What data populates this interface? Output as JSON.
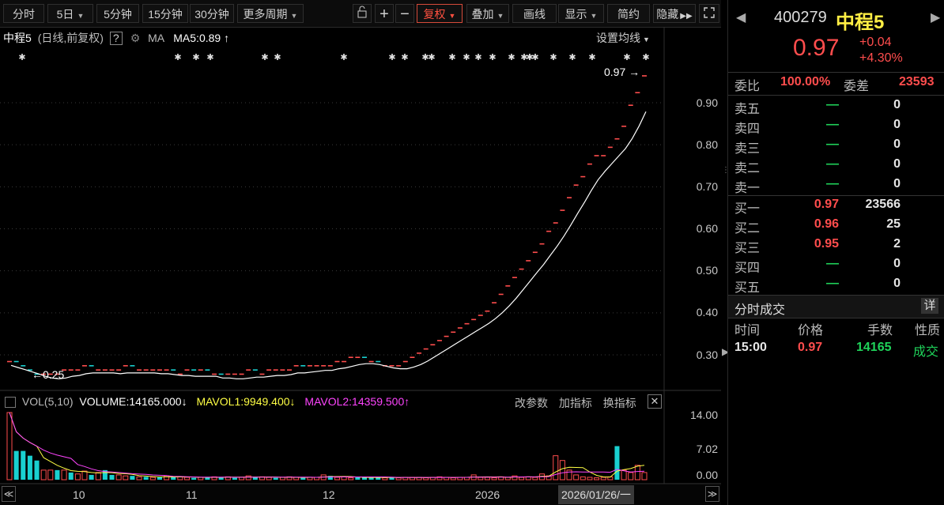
{
  "toolbar": {
    "items": [
      {
        "label": "分时"
      },
      {
        "label": "5日",
        "dropdown": true
      },
      {
        "label": "5分钟"
      },
      {
        "label": "15分钟"
      },
      {
        "label": "30分钟"
      },
      {
        "label": "更多周期",
        "dropdown": true
      }
    ],
    "right_items": [
      {
        "label": "复权",
        "dropdown": true,
        "active": true
      },
      {
        "label": "叠加",
        "dropdown": true
      },
      {
        "label": "画线"
      },
      {
        "label": "显示",
        "dropdown": true
      },
      {
        "label": "简约"
      },
      {
        "label": "隐藏"
      }
    ]
  },
  "chart_header": {
    "name": "中程5",
    "mode": "(日线,前复权)",
    "help": "?",
    "ma_label": "MA",
    "ma5": "MA5:0.89",
    "ma_settings": "设置均线"
  },
  "price_axis": {
    "ticks": [
      "0.90",
      "0.80",
      "0.70",
      "0.60",
      "0.50",
      "0.40",
      "0.30"
    ]
  },
  "annotations": {
    "high": "0.97",
    "low": "0.25"
  },
  "volume_header": {
    "title": "VOL(5,10)",
    "volume": "VOLUME:14165.000",
    "mavol1": "MAVOL1:9949.400",
    "mavol2": "MAVOL2:14359.500",
    "btn_params": "改参数",
    "btn_add": "加指标",
    "btn_switch": "换指标"
  },
  "volume_axis": {
    "ticks": [
      "14.00",
      "7.02",
      "0.00"
    ]
  },
  "x_axis": {
    "labels": [
      "10",
      "11",
      "12",
      "2026"
    ],
    "cursor_date": "2026/01/26/一"
  },
  "colors": {
    "up": "#ff4d4d",
    "down": "#19d0d0",
    "ma": "#ffffff",
    "mavol1": "#ffff44",
    "mavol2": "#ff44ff"
  },
  "quote": {
    "code": "400279",
    "name": "中程5",
    "price": "0.97",
    "change": "+0.04",
    "change_pct": "+4.30%",
    "weibi_label": "委比",
    "weibi": "100.00%",
    "weicha_label": "委差",
    "weicha": "23593"
  },
  "order_book": {
    "asks": [
      {
        "label": "卖五",
        "price": "—",
        "vol": "0"
      },
      {
        "label": "卖四",
        "price": "—",
        "vol": "0"
      },
      {
        "label": "卖三",
        "price": "—",
        "vol": "0"
      },
      {
        "label": "卖二",
        "price": "—",
        "vol": "0"
      },
      {
        "label": "卖一",
        "price": "—",
        "vol": "0"
      }
    ],
    "bids": [
      {
        "label": "买一",
        "price": "0.97",
        "vol": "23566"
      },
      {
        "label": "买二",
        "price": "0.96",
        "vol": "25"
      },
      {
        "label": "买三",
        "price": "0.95",
        "vol": "2"
      },
      {
        "label": "买四",
        "price": "—",
        "vol": "0"
      },
      {
        "label": "买五",
        "price": "—",
        "vol": "0"
      }
    ]
  },
  "trades": {
    "title": "分时成交",
    "detail_btn": "详",
    "headers": [
      "时间",
      "价格",
      "手数",
      "性质"
    ],
    "rows": [
      {
        "time": "15:00",
        "price": "0.97",
        "volume": "14165",
        "nature": "成交"
      }
    ]
  },
  "chart_data": {
    "type": "candlestick",
    "y_axis_ticks": [
      0.3,
      0.4,
      0.5,
      0.6,
      0.7,
      0.8,
      0.9
    ],
    "ylim": [
      0.25,
      0.97
    ],
    "close": [
      0.29,
      0.28,
      0.27,
      0.26,
      0.25,
      0.26,
      0.26,
      0.26,
      0.27,
      0.27,
      0.27,
      0.28,
      0.27,
      0.27,
      0.27,
      0.27,
      0.27,
      0.28,
      0.27,
      0.27,
      0.27,
      0.27,
      0.27,
      0.27,
      0.26,
      0.26,
      0.27,
      0.26,
      0.27,
      0.26,
      0.26,
      0.25,
      0.26,
      0.26,
      0.26,
      0.27,
      0.26,
      0.26,
      0.27,
      0.27,
      0.27,
      0.27,
      0.28,
      0.27,
      0.28,
      0.28,
      0.28,
      0.28,
      0.29,
      0.29,
      0.3,
      0.3,
      0.29,
      0.29,
      0.28,
      0.28,
      0.28,
      0.28,
      0.29,
      0.3,
      0.31,
      0.32,
      0.33,
      0.34,
      0.35,
      0.36,
      0.37,
      0.38,
      0.39,
      0.4,
      0.41,
      0.43,
      0.45,
      0.47,
      0.49,
      0.51,
      0.53,
      0.55,
      0.57,
      0.6,
      0.62,
      0.65,
      0.68,
      0.71,
      0.73,
      0.76,
      0.78,
      0.78,
      0.8,
      0.82,
      0.85,
      0.9,
      0.93,
      0.97
    ],
    "ma5_last": 0.89,
    "volume_ylim": [
      0,
      14
    ],
    "volume": [
      14,
      6,
      6,
      5,
      4,
      2,
      2,
      2,
      2,
      1.5,
      1.2,
      1.8,
      1,
      1.5,
      2,
      1,
      1,
      0.8,
      0.8,
      0.6,
      0.6,
      0.5,
      0.5,
      0.8,
      0.5,
      0.6,
      0.5,
      0.4,
      0.5,
      0.5,
      0.6,
      0.5,
      0.6,
      0.4,
      0.5,
      0.8,
      0.5,
      0.6,
      0.5,
      0.4,
      0.5,
      0.6,
      0.5,
      0.4,
      0.5,
      0.5,
      1,
      0.8,
      0.5,
      0.6,
      0.4,
      0.5,
      0.5,
      0.4,
      0.6,
      0.4,
      0.5,
      0.4,
      0.5,
      0.5,
      0.5,
      0.4,
      0.5,
      0.6,
      0.5,
      0.4,
      0.5,
      0.5,
      1,
      0.5,
      0.5,
      0.4,
      0.6,
      0.5,
      0.8,
      0.5,
      0.6,
      0.5,
      1.2,
      0.8,
      5,
      4,
      2,
      1,
      0.6,
      0.5,
      0.4,
      0.5,
      0.6,
      7,
      2,
      1.5,
      3,
      1.5
    ],
    "volume_up": [
      true,
      false,
      false,
      false,
      false,
      true,
      true,
      false,
      true,
      false,
      true,
      true,
      false,
      true,
      false,
      false,
      true,
      true,
      false,
      true,
      false,
      true,
      false,
      true,
      false,
      true,
      true,
      false,
      true,
      false,
      true,
      false,
      true,
      false,
      true,
      true,
      false,
      true,
      true,
      false,
      true,
      true,
      true,
      false,
      true,
      true,
      true,
      false,
      true,
      true,
      true,
      false,
      false,
      false,
      false,
      true,
      false,
      true,
      true,
      true,
      true,
      true,
      true,
      true,
      true,
      true,
      true,
      true,
      true,
      true,
      true,
      true,
      true,
      true,
      true,
      true,
      true,
      true,
      true,
      true,
      true,
      true,
      true,
      true,
      true,
      true,
      true,
      true,
      true,
      false,
      true,
      true,
      true,
      true
    ],
    "xlabels": [
      "10",
      "11",
      "12",
      "2026"
    ]
  }
}
